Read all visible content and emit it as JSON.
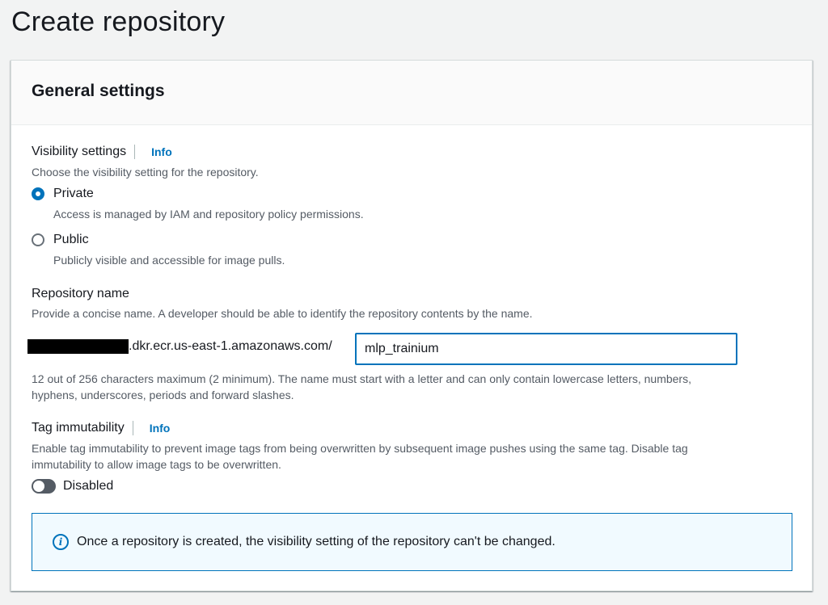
{
  "page": {
    "title": "Create repository"
  },
  "general": {
    "title": "General settings",
    "visibility": {
      "label": "Visibility settings",
      "info": "Info",
      "description": "Choose the visibility setting for the repository.",
      "options": [
        {
          "label": "Private",
          "description": "Access is managed by IAM and repository policy permissions.",
          "selected": true
        },
        {
          "label": "Public",
          "description": "Publicly visible and accessible for image pulls.",
          "selected": false
        }
      ]
    },
    "repo_name": {
      "label": "Repository name",
      "description": "Provide a concise name. A developer should be able to identify the repository contents by the name.",
      "prefix_suffix": ".dkr.ecr.us-east-1.amazonaws.com/",
      "value": "mlp_trainium",
      "constraint_line1": "12 out of 256 characters maximum (2 minimum). The name must start with a letter and can only contain lowercase letters, numbers,",
      "constraint_line2": "hyphens, underscores, periods and forward slashes."
    },
    "tag_immutability": {
      "label": "Tag immutability",
      "info": "Info",
      "description_line1": "Enable tag immutability to prevent image tags from being overwritten by subsequent image pushes using the same tag. Disable tag",
      "description_line2": "immutability to allow image tags to be overwritten.",
      "toggle_label": "Disabled",
      "enabled": false
    },
    "alert": {
      "text": "Once a repository is created, the visibility setting of the repository can't be changed.",
      "icon": "info-circle-icon"
    }
  },
  "colors": {
    "accent": "#0073bb",
    "alert_bg": "#f1faff",
    "page_bg": "#f2f3f3"
  }
}
